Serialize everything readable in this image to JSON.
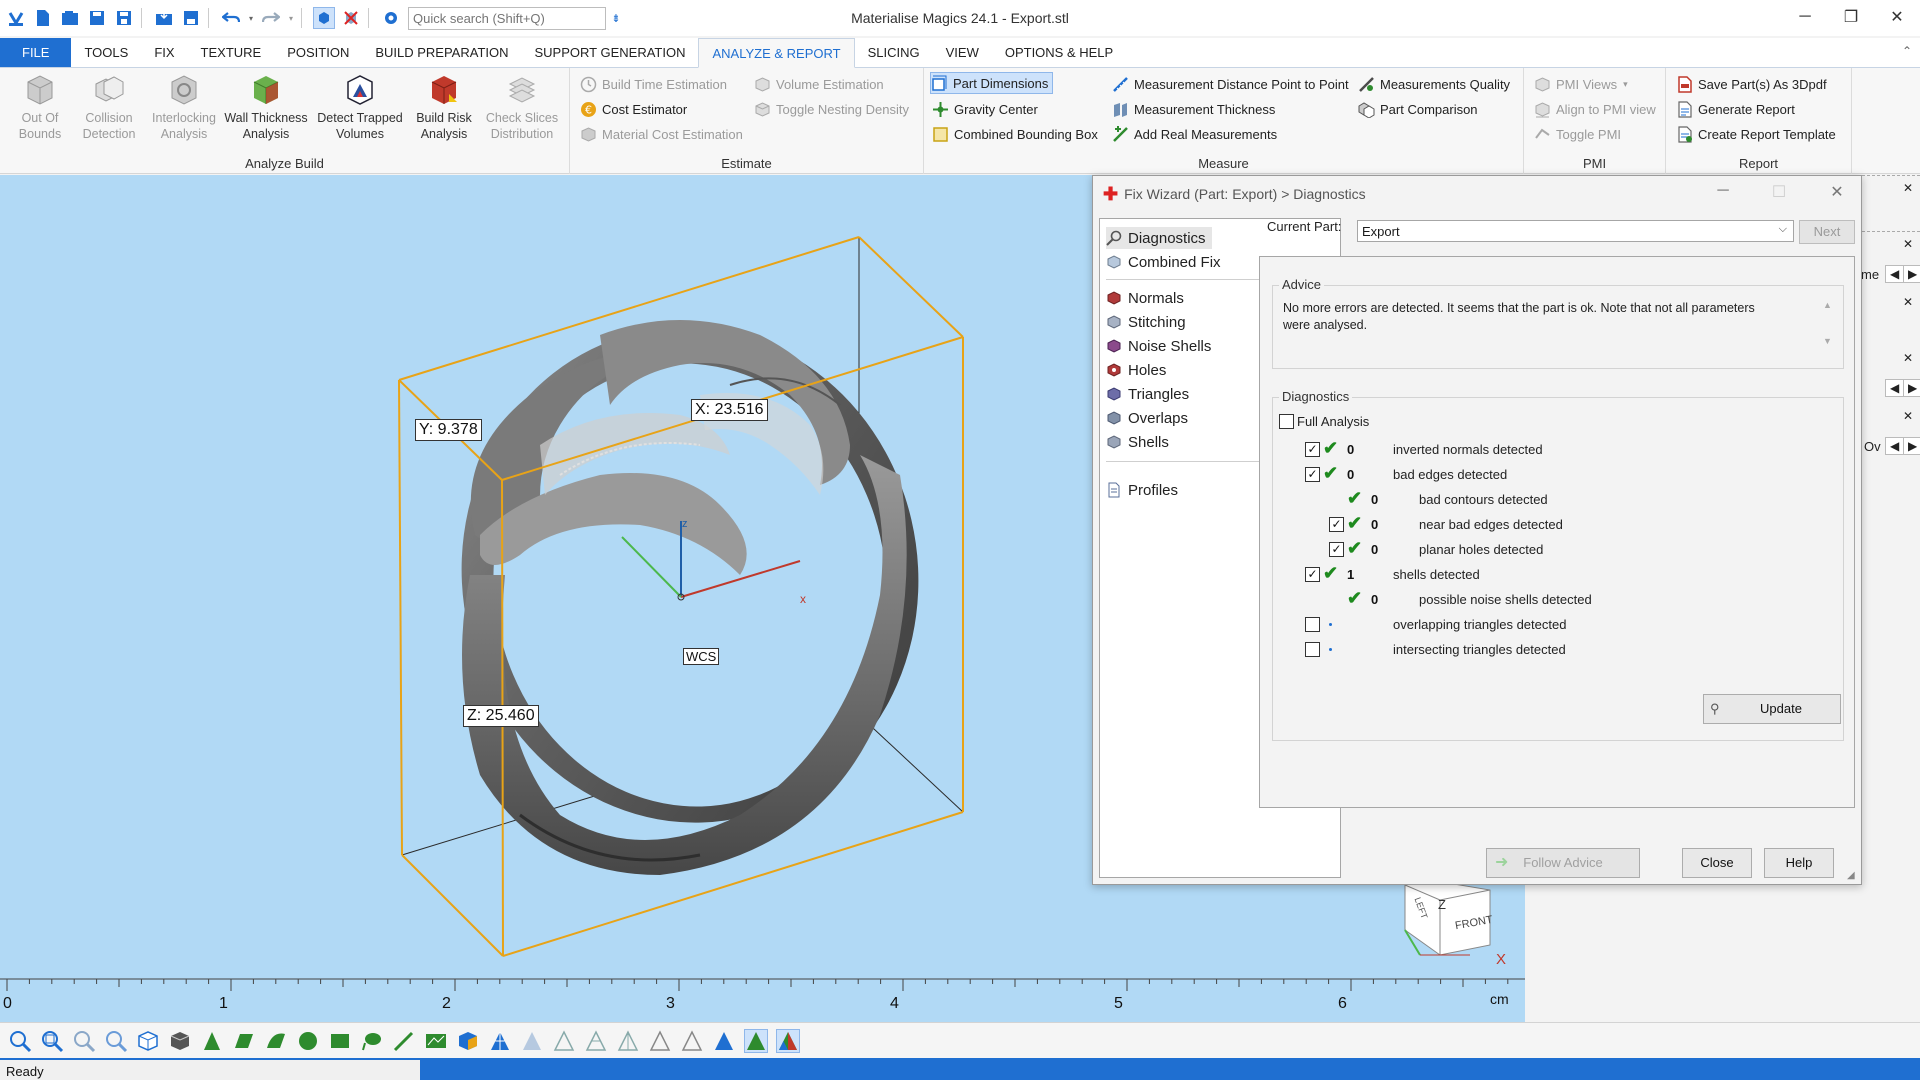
{
  "app": {
    "title": "Materialise Magics 24.1 - Export.stl"
  },
  "quick_search": {
    "placeholder": "Quick search (Shift+Q)"
  },
  "menu": {
    "tabs": [
      "FILE",
      "TOOLS",
      "FIX",
      "TEXTURE",
      "POSITION",
      "BUILD PREPARATION",
      "SUPPORT GENERATION",
      "ANALYZE & REPORT",
      "SLICING",
      "VIEW",
      "OPTIONS & HELP"
    ],
    "active": "ANALYZE & REPORT"
  },
  "ribbon": {
    "analyze_build": {
      "label": "Analyze Build",
      "out_of_bounds": "Out Of Bounds",
      "collision_detection": "Collision Detection",
      "interlocking_analysis": "Interlocking Analysis",
      "wall_thickness": "Wall Thickness Analysis",
      "detect_trapped": "Detect Trapped Volumes",
      "build_risk": "Build Risk Analysis",
      "check_slices": "Check Slices Distribution"
    },
    "estimate": {
      "label": "Estimate",
      "build_time": "Build Time Estimation",
      "cost_estimator": "Cost Estimator",
      "material_cost": "Material Cost Estimation",
      "volume_estimation": "Volume Estimation",
      "toggle_nesting": "Toggle Nesting Density"
    },
    "measure": {
      "label": "Measure",
      "part_dimensions": "Part Dimensions",
      "gravity_center": "Gravity Center",
      "combined_bbox": "Combined Bounding Box",
      "distance_p2p": "Measurement Distance Point to Point",
      "thickness": "Measurement Thickness",
      "add_real": "Add Real Measurements",
      "quality": "Measurements Quality",
      "comparison": "Part Comparison"
    },
    "pmi": {
      "label": "PMI",
      "pmi_views": "PMI Views",
      "align": "Align to PMI view",
      "toggle": "Toggle PMI"
    },
    "report": {
      "label": "Report",
      "save_3dpdf": "Save Part(s) As 3Dpdf",
      "generate": "Generate Report",
      "create_template": "Create Report Template"
    }
  },
  "viewport": {
    "dim_x": "X: 23.516",
    "dim_y": "Y: 9.378",
    "dim_z": "Z: 25.460",
    "axis_z": "z",
    "axis_x": "x",
    "wcs": "WCS",
    "cube_front": "FRONT",
    "cube_left": "LEFT",
    "cube_z": "Z",
    "cube_x": "X"
  },
  "ruler": {
    "ticks": [
      "0",
      "1",
      "2",
      "3",
      "4",
      "5",
      "6"
    ],
    "unit": "cm"
  },
  "dialog": {
    "title": "Fix Wizard (Part: Export) > Diagnostics",
    "nav": {
      "diagnostics": "Diagnostics",
      "combined_fix": "Combined Fix",
      "normals": "Normals",
      "stitching": "Stitching",
      "noise_shells": "Noise Shells",
      "holes": "Holes",
      "triangles": "Triangles",
      "overlaps": "Overlaps",
      "shells": "Shells",
      "profiles": "Profiles"
    },
    "current_part_label": "Current Part:",
    "current_part_value": "Export",
    "next": "Next",
    "advice_label": "Advice",
    "advice_text_1": "No more errors are detected. It seems that the part is ok. Note that not all parameters",
    "advice_text_2": "were analysed.",
    "diagnostics_label": "Diagnostics",
    "full_analysis": "Full Analysis",
    "rows": [
      {
        "count": "0",
        "label": "inverted normals detected"
      },
      {
        "count": "0",
        "label": "bad edges detected"
      },
      {
        "count": "0",
        "label": "bad contours detected"
      },
      {
        "count": "0",
        "label": "near bad edges detected"
      },
      {
        "count": "0",
        "label": "planar holes detected"
      },
      {
        "count": "1",
        "label": "shells detected"
      },
      {
        "count": "0",
        "label": "possible noise shells detected"
      },
      {
        "count": "",
        "label": "overlapping triangles detected"
      },
      {
        "count": "",
        "label": "intersecting triangles detected"
      }
    ],
    "update": "Update",
    "follow_advice": "Follow Advice",
    "close": "Close",
    "help": "Help"
  },
  "right_panel": {
    "tab_text_1": "me",
    "tab_text_2": "Ov"
  },
  "status": {
    "text": "Ready"
  }
}
